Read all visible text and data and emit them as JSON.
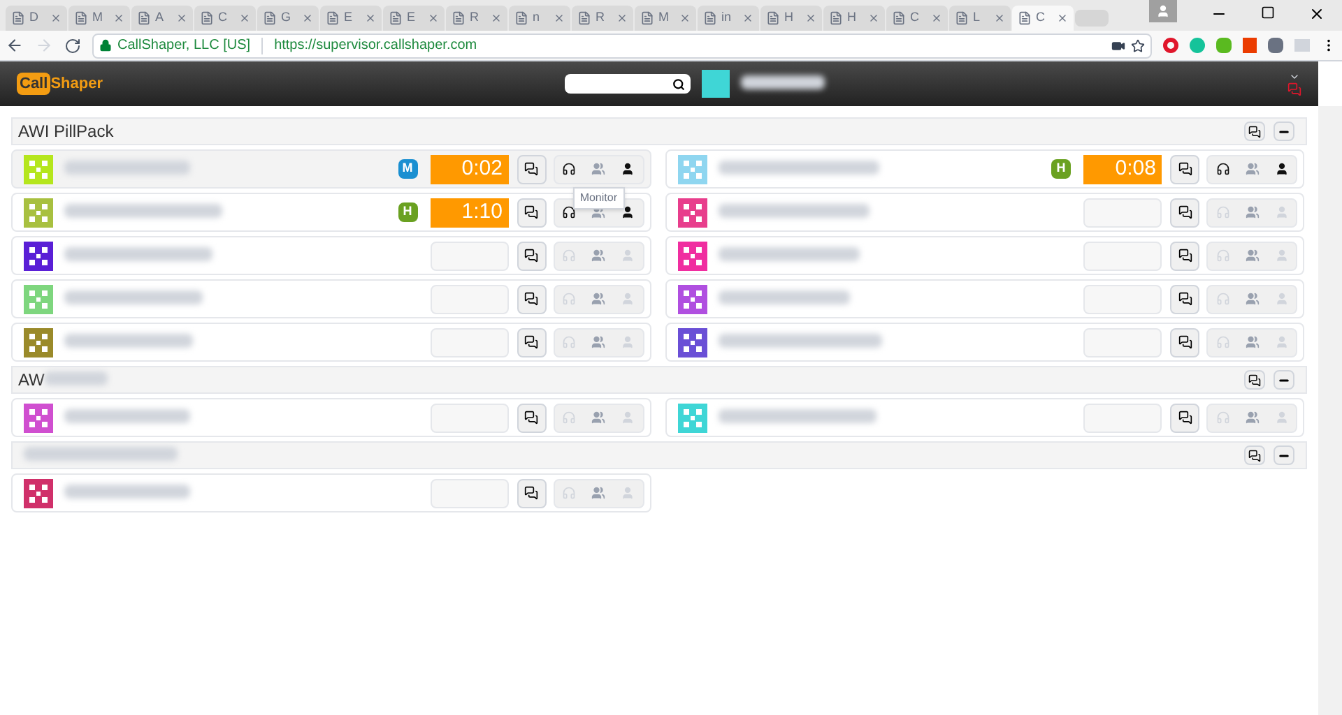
{
  "browser": {
    "tabs": [
      {
        "title": "D",
        "selected": false
      },
      {
        "title": "M",
        "selected": false
      },
      {
        "title": "A",
        "selected": false
      },
      {
        "title": "C",
        "selected": false
      },
      {
        "title": "G",
        "selected": false
      },
      {
        "title": "E",
        "selected": false
      },
      {
        "title": "E",
        "selected": false
      },
      {
        "title": "R",
        "selected": false
      },
      {
        "title": "n",
        "selected": false
      },
      {
        "title": "R",
        "selected": false
      },
      {
        "title": "M",
        "selected": false
      },
      {
        "title": "in",
        "selected": false
      },
      {
        "title": "H",
        "selected": false
      },
      {
        "title": "H",
        "selected": false
      },
      {
        "title": "C",
        "selected": false
      },
      {
        "title": "L",
        "selected": false
      },
      {
        "title": "C",
        "selected": true
      }
    ],
    "secure_label": "CallShaper, LLC [US]",
    "url": "https://supervisor.callshaper.com"
  },
  "header": {
    "logo_box": "Call",
    "logo_rest": "Shaper"
  },
  "groups": [
    {
      "title": "AWI PillPack",
      "title_blurred": false,
      "agents": [
        {
          "badge": {
            "label": "M",
            "color": "#1a8fd1"
          },
          "timer": "0:02",
          "on_call": true,
          "highlighted": true,
          "tooltip": "Monitor",
          "color": "#b5e61d"
        },
        {
          "badge": {
            "label": "H",
            "color": "#6aa121"
          },
          "timer": "1:10",
          "on_call": true,
          "highlighted": false,
          "color": "#a8c040"
        },
        {
          "on_call": false,
          "highlighted": false,
          "color": "#5a1fd6"
        },
        {
          "on_call": false,
          "highlighted": false,
          "color": "#7ed67e"
        },
        {
          "on_call": false,
          "highlighted": false,
          "color": "#9a8a2a"
        },
        {
          "badge": {
            "label": "H",
            "color": "#6aa121"
          },
          "timer": "0:08",
          "on_call": true,
          "highlighted": false,
          "color": "#8fd6f0"
        },
        {
          "on_call": false,
          "highlighted": false,
          "color": "#e83e8c"
        },
        {
          "on_call": false,
          "highlighted": false,
          "color": "#f02ea0"
        },
        {
          "on_call": false,
          "highlighted": false,
          "color": "#b04fe0"
        },
        {
          "on_call": false,
          "highlighted": false,
          "color": "#6a4fd6"
        }
      ]
    },
    {
      "title": "AW",
      "title_blurred": true,
      "agents": [
        {
          "on_call": false,
          "highlighted": false,
          "color": "#d04fd0"
        },
        {
          "on_call": false,
          "highlighted": false,
          "color": "#3fd6d6"
        }
      ]
    },
    {
      "title_blurred": true,
      "agents": [
        {
          "on_call": false,
          "highlighted": false,
          "color": "#d0306a"
        }
      ]
    }
  ]
}
